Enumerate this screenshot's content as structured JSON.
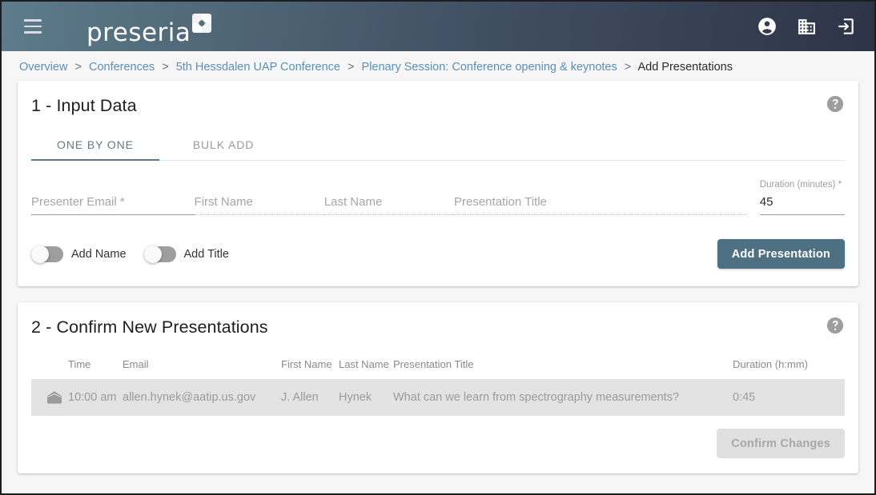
{
  "appbar": {
    "menu_icon": "hamburger-menu-icon",
    "brand_text": "preseria",
    "brand_mark_icon": "preseria-logo-mark",
    "actions": [
      {
        "icon": "account-circle-icon",
        "name": "account-button"
      },
      {
        "icon": "business-building-icon",
        "name": "organization-button"
      },
      {
        "icon": "logout-arrow-icon",
        "name": "logout-button"
      }
    ],
    "gradient_from": "#5e7c8c",
    "gradient_to": "#2e3447"
  },
  "breadcrumb": {
    "items": [
      {
        "label": "Overview",
        "current": false
      },
      {
        "label": "Conferences",
        "current": false
      },
      {
        "label": "5th Hessdalen UAP Conference",
        "current": false
      },
      {
        "label": "Plenary Session: Conference opening & keynotes",
        "current": false
      },
      {
        "label": "Add Presentations",
        "current": true
      }
    ],
    "separator": ">",
    "link_color": "#5b8fb9"
  },
  "input_card": {
    "title": "1 - Input Data",
    "help_icon": "help-circle-icon",
    "tabs": [
      {
        "label": "ONE BY ONE",
        "active": true
      },
      {
        "label": "BULK ADD",
        "active": false
      }
    ],
    "fields": {
      "email": {
        "placeholder": "Presenter Email *",
        "value": "",
        "enabled": true
      },
      "first_name": {
        "placeholder": "First Name",
        "value": "",
        "enabled": false
      },
      "last_name": {
        "placeholder": "Last Name",
        "value": "",
        "enabled": false
      },
      "title": {
        "placeholder": "Presentation Title",
        "value": "",
        "enabled": false
      },
      "duration": {
        "label": "Duration (minutes) *",
        "value": "45",
        "enabled": true
      }
    },
    "toggles": [
      {
        "label": "Add Name",
        "on": false
      },
      {
        "label": "Add Title",
        "on": false
      }
    ],
    "submit_label": "Add Presentation",
    "accent_color": "#4e7083"
  },
  "confirm_card": {
    "title": "2 - Confirm New Presentations",
    "help_icon": "help-circle-icon",
    "columns": {
      "icon": "",
      "time": "Time",
      "email": "Email",
      "first_name": "First Name",
      "last_name": "Last Name",
      "title": "Presentation Title",
      "duration": "Duration (h:mm)"
    },
    "rows": [
      {
        "icon": "mail-open-icon",
        "time": "10:00 am",
        "email": "allen.hynek@aatip.us.gov",
        "first_name": "J. Allen",
        "last_name": "Hynek",
        "title": "What can we learn from spectrography measurements?",
        "duration": "0:45"
      }
    ],
    "confirm_label": "Confirm Changes",
    "confirm_enabled": false
  }
}
